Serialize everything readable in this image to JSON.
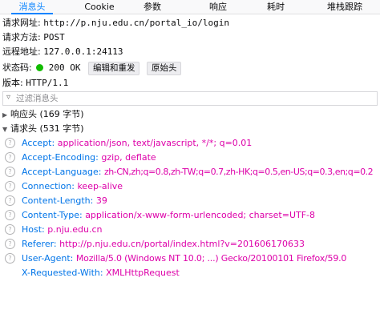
{
  "tabs": [
    {
      "label": "消息头"
    },
    {
      "label": "Cookie"
    },
    {
      "label": "参数"
    },
    {
      "label": "响应"
    },
    {
      "label": "耗时"
    },
    {
      "label": "堆栈跟踪"
    }
  ],
  "summary": {
    "request_url": {
      "label": "请求网址:",
      "value": "http://p.nju.edu.cn/portal_io/login"
    },
    "request_method": {
      "label": "请求方法:",
      "value": "POST"
    },
    "remote_address": {
      "label": "远程地址:",
      "value": "127.0.0.1:24113"
    },
    "status": {
      "label": "状态码:",
      "value": "200 OK",
      "edit_resend": "编辑和重发",
      "raw_headers": "原始头"
    },
    "version": {
      "label": "版本:",
      "value": "HTTP/1.1"
    }
  },
  "filter": {
    "placeholder": "过滤消息头"
  },
  "response_headers": {
    "label": "响应头 (169 字节)"
  },
  "request_headers": {
    "label": "请求头 (531 字节)",
    "items": [
      {
        "name": "Accept:",
        "value": "application/json, text/javascript, */*; q=0.01"
      },
      {
        "name": "Accept-Encoding:",
        "value": "gzip, deflate"
      },
      {
        "name": "Accept-Language:",
        "value": "zh-CN,zh;q=0.8,zh-TW;q=0.7,zh-HK;q=0.5,en-US;q=0.3,en;q=0.2"
      },
      {
        "name": "Connection:",
        "value": "keep-alive"
      },
      {
        "name": "Content-Length:",
        "value": "39"
      },
      {
        "name": "Content-Type:",
        "value": "application/x-www-form-urlencoded; charset=UTF-8"
      },
      {
        "name": "Host:",
        "value": "p.nju.edu.cn"
      },
      {
        "name": "Referer:",
        "value": "http://p.nju.edu.cn/portal/index.html?v=201606170633"
      },
      {
        "name": "User-Agent:",
        "value": "Mozilla/5.0 (Windows NT 10.0; ...) Gecko/20100101 Firefox/59.0"
      },
      {
        "name": "X-Requested-With:",
        "value": "XMLHttpRequest"
      }
    ]
  },
  "colors": {
    "accent": "#0a84ff",
    "header_name": "#0074e8",
    "header_value": "#dd00a9",
    "status_ok": "#12bc00"
  }
}
